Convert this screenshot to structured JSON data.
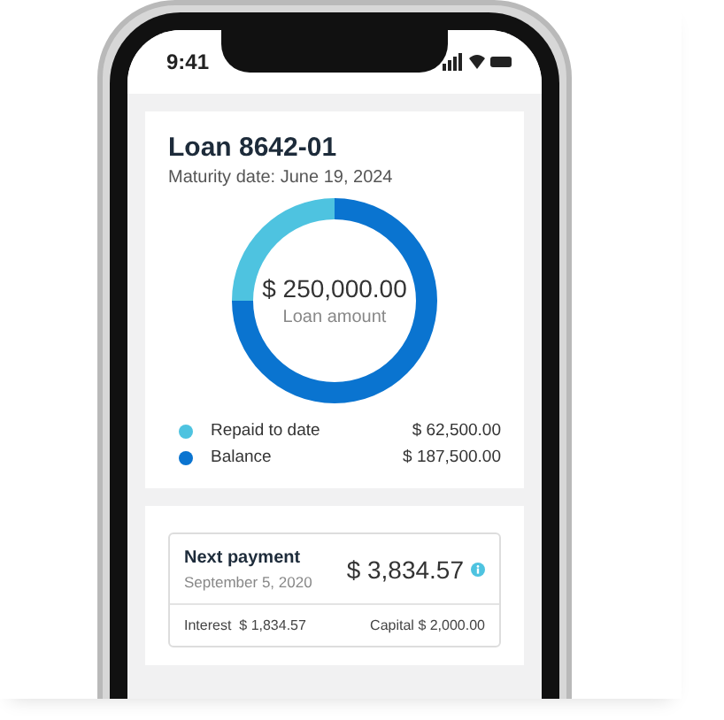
{
  "status_bar": {
    "time": "9:41"
  },
  "loan": {
    "title": "Loan 8642-01",
    "maturity": "Maturity date: June 19, 2024",
    "center_amount": "$ 250,000.00",
    "center_label": "Loan amount",
    "chart_data": {
      "type": "donut",
      "categories": [
        "Repaid to date",
        "Balance"
      ],
      "values": [
        25,
        75
      ]
    },
    "legend": [
      {
        "amount": "$ 62,500.00",
        "color": "#4ec3e0"
      },
      {
        "amount": "$ 187,500.00",
        "color": "#0a74d0"
      }
    ]
  },
  "next_payment": {
    "title": "Next payment",
    "date": "September 5, 2020",
    "amount": "$ 3,834.57",
    "interest_label": "Interest",
    "interest": "$ 1,834.57",
    "capital_label": "Capital",
    "capital": "$ 2,000.00"
  }
}
